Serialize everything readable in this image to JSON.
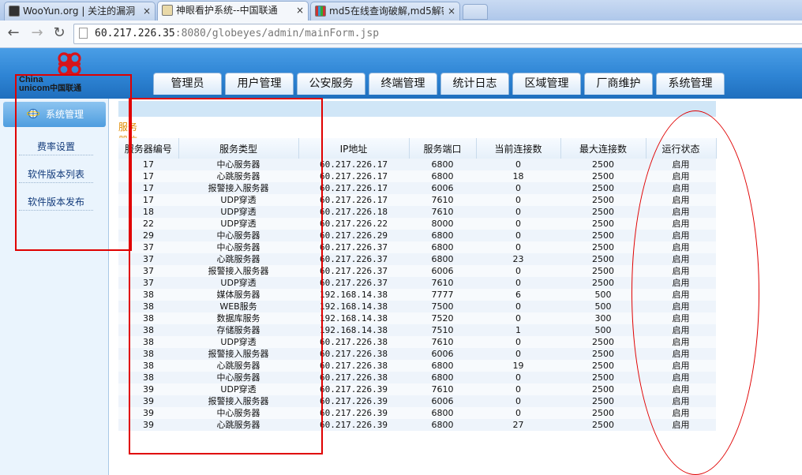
{
  "browser": {
    "tabs": [
      {
        "title": "WooYun.org | 关注的漏洞"
      },
      {
        "title": "神眼看护系统--中国联通"
      },
      {
        "title": "md5在线查询破解,md5解密"
      }
    ],
    "close_glyph": "×",
    "url_host": "60.217.226.35",
    "url_rest": ":8080/globeyes/admin/mainForm.jsp"
  },
  "logo": {
    "line1": "China",
    "line2": "unicom",
    "cn": "中国联通"
  },
  "menu": [
    "管理员",
    "用户管理",
    "公安服务",
    "终端管理",
    "统计日志",
    "区域管理",
    "厂商维护",
    "系统管理"
  ],
  "sidebar": {
    "header": "系统管理",
    "items": [
      "费率设置",
      "软件版本列表",
      "软件版本发布"
    ]
  },
  "content": {
    "section_label": "服务器信息：",
    "columns": [
      "服务器编号",
      "服务类型",
      "IP地址",
      "服务端口",
      "当前连接数",
      "最大连接数",
      "运行状态"
    ],
    "rows": [
      [
        "17",
        "中心服务器",
        "60.217.226.17",
        "6800",
        "0",
        "2500",
        "启用"
      ],
      [
        "17",
        "心跳服务器",
        "60.217.226.17",
        "6800",
        "18",
        "2500",
        "启用"
      ],
      [
        "17",
        "报警接入服务器",
        "60.217.226.17",
        "6006",
        "0",
        "2500",
        "启用"
      ],
      [
        "17",
        "UDP穿透",
        "60.217.226.17",
        "7610",
        "0",
        "2500",
        "启用"
      ],
      [
        "18",
        "UDP穿透",
        "60.217.226.18",
        "7610",
        "0",
        "2500",
        "启用"
      ],
      [
        "22",
        "UDP穿透",
        "60.217.226.22",
        "8000",
        "0",
        "2500",
        "启用"
      ],
      [
        "29",
        "中心服务器",
        "60.217.226.29",
        "6800",
        "0",
        "2500",
        "启用"
      ],
      [
        "37",
        "中心服务器",
        "60.217.226.37",
        "6800",
        "0",
        "2500",
        "启用"
      ],
      [
        "37",
        "心跳服务器",
        "60.217.226.37",
        "6800",
        "23",
        "2500",
        "启用"
      ],
      [
        "37",
        "报警接入服务器",
        "60.217.226.37",
        "6006",
        "0",
        "2500",
        "启用"
      ],
      [
        "37",
        "UDP穿透",
        "60.217.226.37",
        "7610",
        "0",
        "2500",
        "启用"
      ],
      [
        "38",
        "媒体服务器",
        "192.168.14.38",
        "7777",
        "6",
        "500",
        "启用"
      ],
      [
        "38",
        "WEB服务",
        "192.168.14.38",
        "7500",
        "0",
        "500",
        "启用"
      ],
      [
        "38",
        "数据库服务",
        "192.168.14.38",
        "7520",
        "0",
        "300",
        "启用"
      ],
      [
        "38",
        "存储服务器",
        "192.168.14.38",
        "7510",
        "1",
        "500",
        "启用"
      ],
      [
        "38",
        "UDP穿透",
        "60.217.226.38",
        "7610",
        "0",
        "2500",
        "启用"
      ],
      [
        "38",
        "报警接入服务器",
        "60.217.226.38",
        "6006",
        "0",
        "2500",
        "启用"
      ],
      [
        "38",
        "心跳服务器",
        "60.217.226.38",
        "6800",
        "19",
        "2500",
        "启用"
      ],
      [
        "38",
        "中心服务器",
        "60.217.226.38",
        "6800",
        "0",
        "2500",
        "启用"
      ],
      [
        "39",
        "UDP穿透",
        "60.217.226.39",
        "7610",
        "0",
        "2500",
        "启用"
      ],
      [
        "39",
        "报警接入服务器",
        "60.217.226.39",
        "6006",
        "0",
        "2500",
        "启用"
      ],
      [
        "39",
        "中心服务器",
        "60.217.226.39",
        "6800",
        "0",
        "2500",
        "启用"
      ],
      [
        "39",
        "心跳服务器",
        "60.217.226.39",
        "6800",
        "27",
        "2500",
        "启用"
      ]
    ]
  },
  "colors": {
    "header_blue": "#2e84d4",
    "annotation_red": "#e00000",
    "section_label": "#e08a00",
    "service_link": "#1a3d9c"
  }
}
